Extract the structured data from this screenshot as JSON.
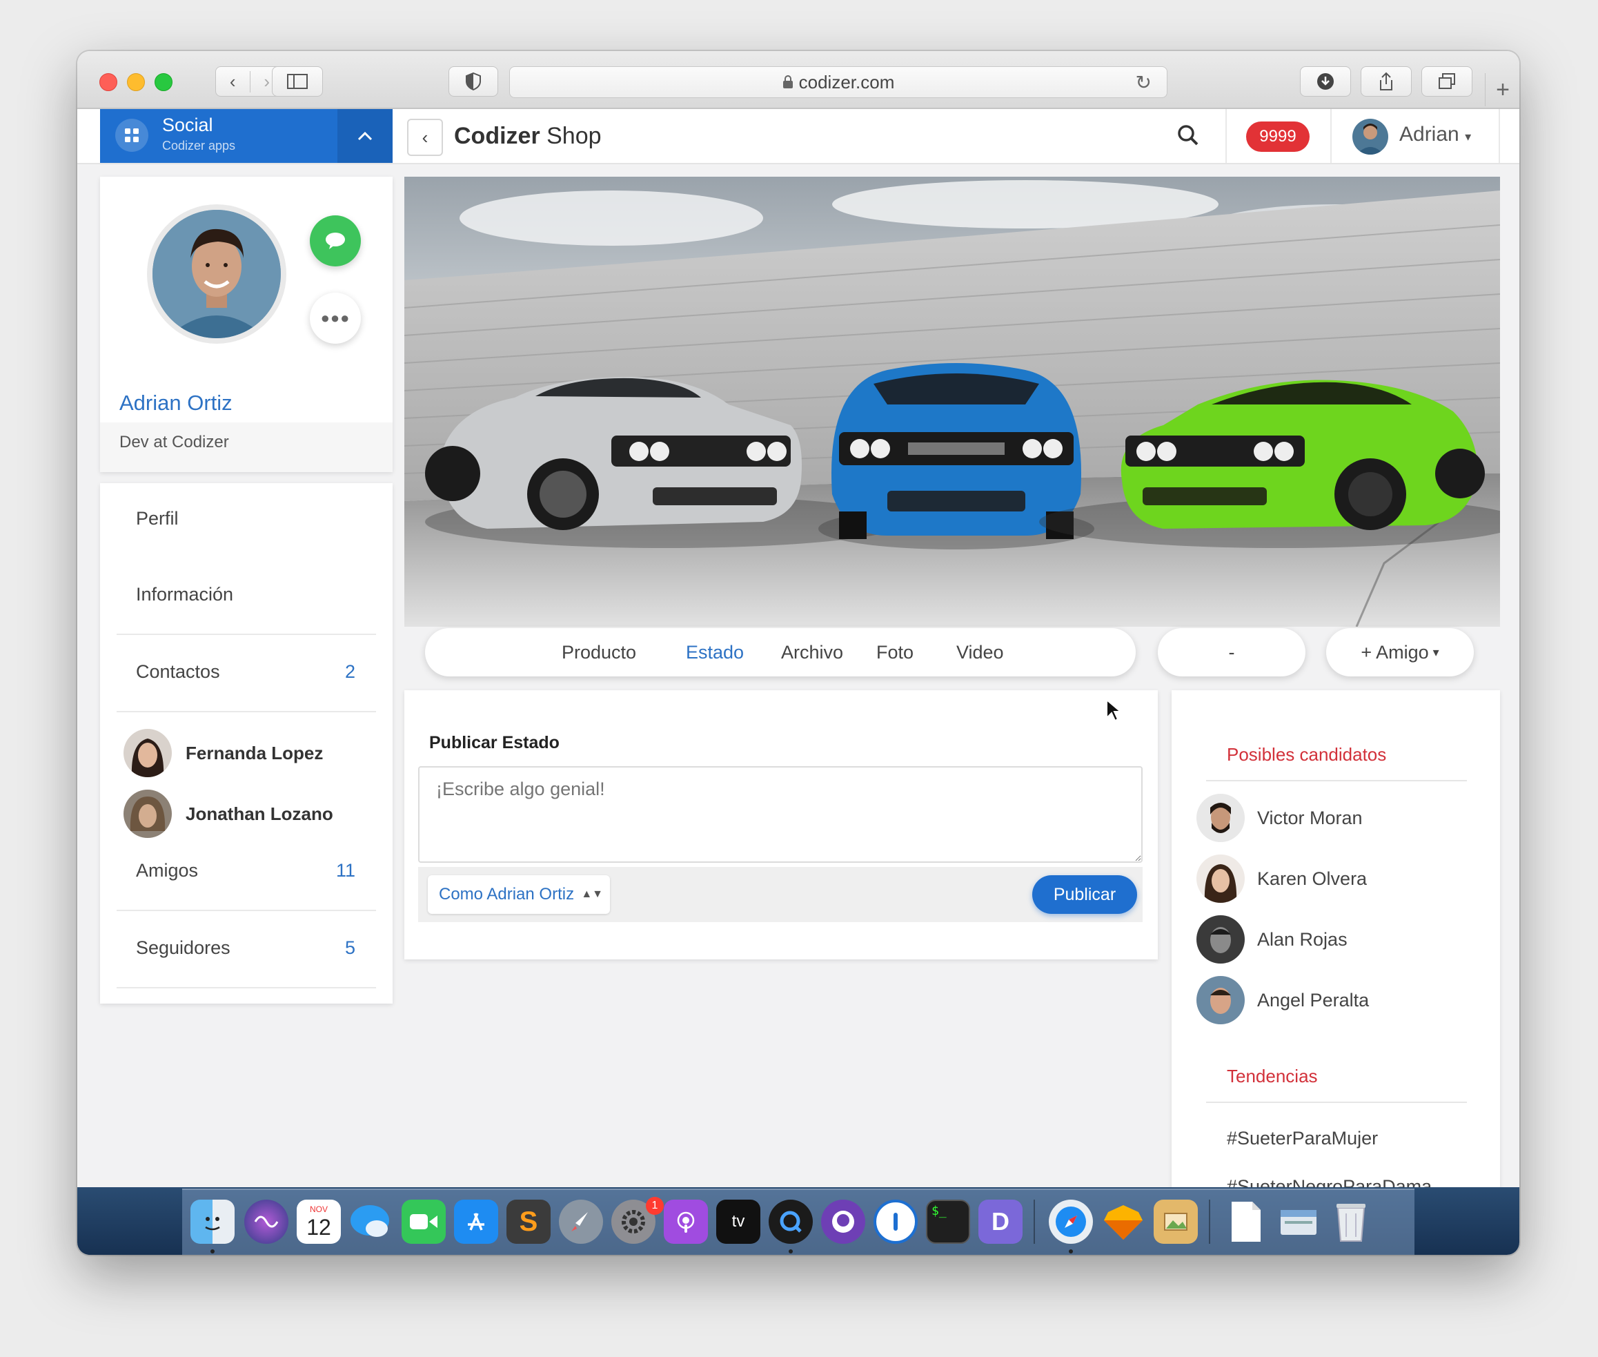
{
  "browser": {
    "url": "codizer.com",
    "lock_icon": "lock-icon"
  },
  "app": {
    "brand_title": "Social",
    "brand_subtitle": "Codizer apps",
    "title_bold": "Codizer",
    "title_rest": " Shop",
    "notification_count": "9999",
    "user_name": "Adrian"
  },
  "profile": {
    "name": "Adrian Ortiz",
    "role": "Dev at Codizer"
  },
  "menu": {
    "perfil": "Perfil",
    "informacion": "Información",
    "contactos": "Contactos",
    "contactos_count": "2",
    "contacts": [
      {
        "name": "Fernanda Lopez"
      },
      {
        "name": "Jonathan Lozano"
      }
    ],
    "amigos": "Amigos",
    "amigos_count": "11",
    "seguidores": "Seguidores",
    "seguidores_count": "5"
  },
  "tabs": [
    "Producto",
    "Estado",
    "Archivo",
    "Foto",
    "Video"
  ],
  "active_tab": "Estado",
  "dash_button": "-",
  "friend_button": "+ Amigo",
  "post": {
    "title": "Publicar Estado",
    "placeholder": "¡Escribe algo genial!",
    "as_user": "Como Adrian Ortiz",
    "publish_label": "Publicar"
  },
  "sidebar": {
    "candidates_title": "Posibles candidatos",
    "candidates": [
      {
        "name": "Victor Moran"
      },
      {
        "name": "Karen Olvera"
      },
      {
        "name": "Alan Rojas"
      },
      {
        "name": "Angel Peralta"
      }
    ],
    "trends_title": "Tendencias",
    "trends": [
      "#SueterParaMujer",
      "#SueterNegroParaDama"
    ]
  },
  "dock": {
    "calendar_month": "NOV",
    "calendar_day": "12",
    "settings_badge": "1",
    "tv_label": "tv"
  },
  "colors": {
    "primary": "#1f6fcf",
    "accent_red": "#d2313a",
    "badge_red": "#e23236",
    "chat_green": "#3ec45c"
  }
}
